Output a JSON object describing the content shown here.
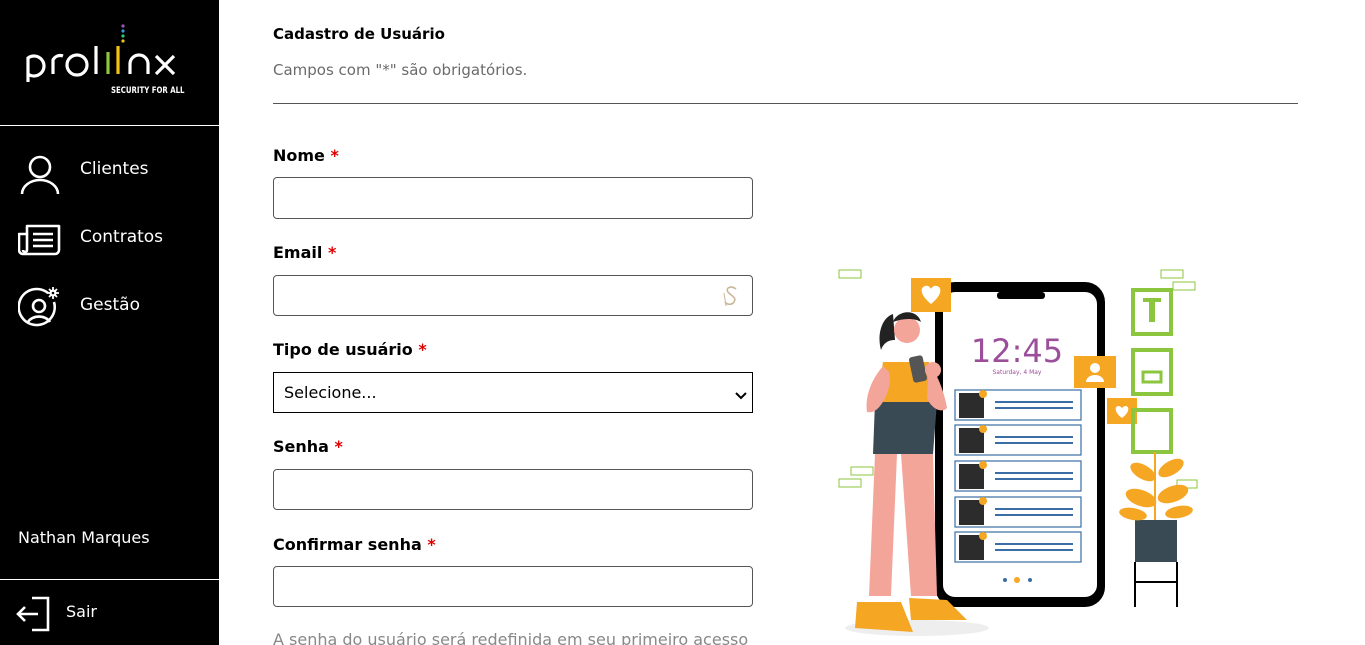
{
  "sidebar": {
    "logo_text": "prolinx",
    "logo_tagline": "SECURITY FOR ALL",
    "items": [
      {
        "label": "Clientes",
        "icon": "user-icon"
      },
      {
        "label": "Contratos",
        "icon": "newspaper-icon"
      },
      {
        "label": "Gestão",
        "icon": "user-gear-icon"
      }
    ],
    "user_name": "Nathan Marques",
    "logout_label": "Sair"
  },
  "form": {
    "title": "Cadastro de Usuário",
    "subtitle": "Campos com \"*\" são obrigatórios.",
    "required_mark": "*",
    "fields": {
      "nome": {
        "label": "Nome",
        "value": ""
      },
      "email": {
        "label": "Email",
        "value": ""
      },
      "tipo": {
        "label": "Tipo de usuário",
        "selected": "Selecione..."
      },
      "senha": {
        "label": "Senha",
        "value": ""
      },
      "confirmar": {
        "label": "Confirmar senha",
        "value": ""
      }
    },
    "helper": "A senha do usuário será redefinida em seu primeiro acesso"
  },
  "illustration": {
    "clock_time": "12:45",
    "clock_date": "Saturday, 4 May"
  },
  "colors": {
    "sidebar_bg": "#000000",
    "required": "#e00000",
    "accent_orange": "#f5a623",
    "accent_purple": "#9b4f9b",
    "accent_green": "#8cc63f",
    "accent_pink": "#f4a59a"
  }
}
